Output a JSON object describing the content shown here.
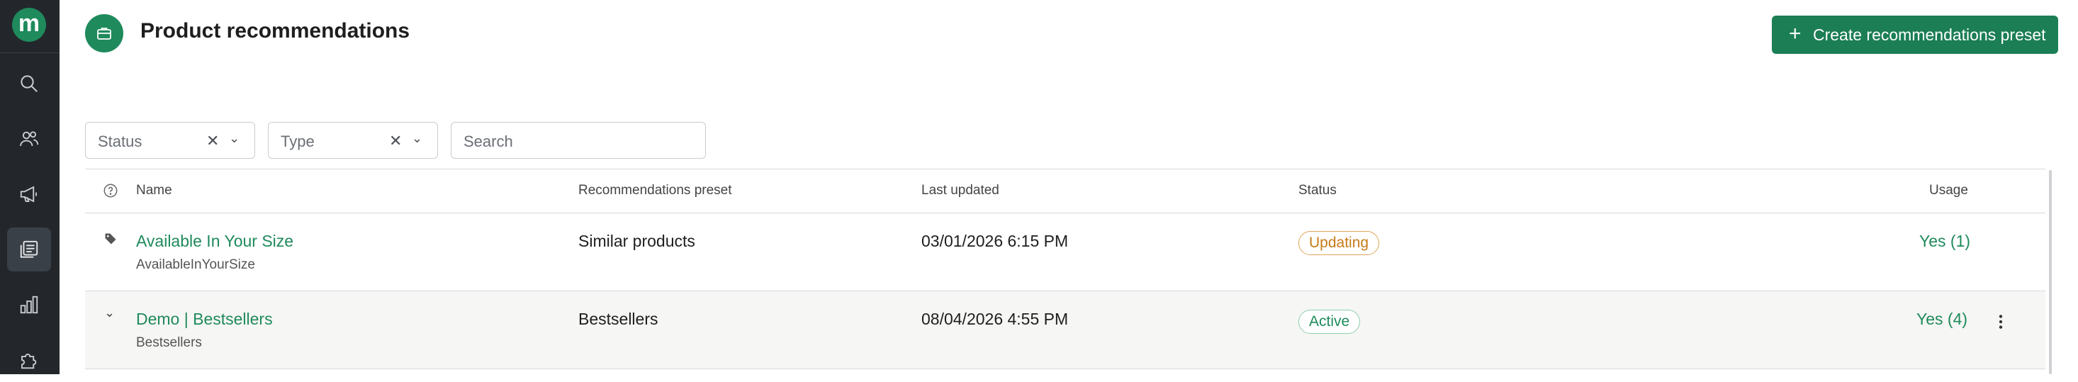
{
  "app": {
    "logo_letter": "m"
  },
  "sidebar": {
    "items": [
      {
        "name": "search",
        "icon": "search-icon"
      },
      {
        "name": "users",
        "icon": "users-icon"
      },
      {
        "name": "campaigns",
        "icon": "megaphone-icon"
      },
      {
        "name": "content",
        "icon": "content-icon",
        "active": true
      },
      {
        "name": "analytics",
        "icon": "bar-chart-icon"
      },
      {
        "name": "integrations",
        "icon": "puzzle-icon"
      }
    ]
  },
  "header": {
    "title": "Product recommendations",
    "icon": "briefcase-icon",
    "create_button": "Create recommendations preset"
  },
  "filters": {
    "status_placeholder": "Status",
    "type_placeholder": "Type",
    "search_placeholder": "Search"
  },
  "table": {
    "columns": {
      "name": "Name",
      "preset": "Recommendations preset",
      "updated": "Last updated",
      "status": "Status",
      "usage": "Usage"
    },
    "rows": [
      {
        "name": "Available In Your Size",
        "id": "AvailableInYourSize",
        "preset": "Similar products",
        "updated": "03/01/2026 6:15 PM",
        "status": "Updating",
        "usage": "Yes (1)"
      },
      {
        "name": "Demo | Bestsellers",
        "id": "Bestsellers",
        "preset": "Bestsellers",
        "updated": "08/04/2026 4:55 PM",
        "status": "Active",
        "usage": "Yes (4)"
      }
    ]
  },
  "colors": {
    "brand": "#1f8a5c",
    "sidebar": "#23272c",
    "warning": "#c77a17"
  }
}
